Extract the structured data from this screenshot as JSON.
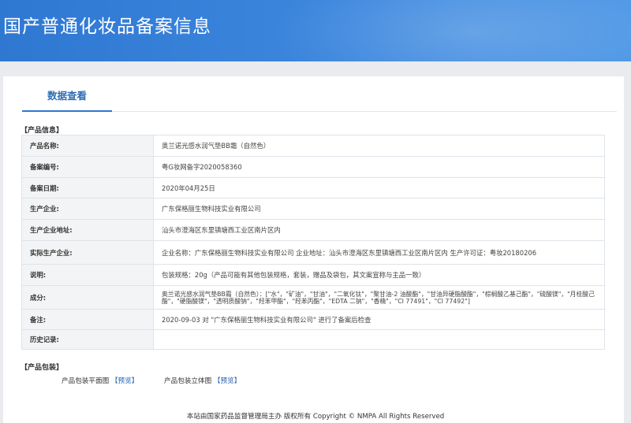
{
  "header": {
    "title": "国产普通化妆品备案信息"
  },
  "tab": {
    "label": "数据查看"
  },
  "product_info": {
    "section_title": "【产品信息】",
    "rows": [
      {
        "label": "产品名称:",
        "value": "奥兰诺光感水润气垫BB霜（自然色）"
      },
      {
        "label": "备案编号:",
        "value": "粤G妆网备字2020058360"
      },
      {
        "label": "备案日期:",
        "value": "2020年04月25日"
      },
      {
        "label": "生产企业:",
        "value": "广东保格丽生物科技实业有限公司"
      },
      {
        "label": "生产企业地址:",
        "value": "汕头市澄海区东里镇塘西工业区南片区内"
      },
      {
        "label": "实际生产企业:",
        "value": "企业名称：广东保格丽生物科技实业有限公司 企业地址：汕头市澄海区东里镇塘西工业区南片区内 生产许可证：粤妆20180206"
      },
      {
        "label": "说明:",
        "value": "包装规格：20g（产品可能有其他包装规格，套装，赠品及袋包，其文案宣称与主品一致）"
      },
      {
        "label": "成分:",
        "value": "奥兰诺光感水润气垫BB霜（自然色）：[\"水\"，\"矿油\"，\"甘油\"，\"二氧化钛\"，\"聚甘油-2 油酸酯\"，\"甘油异硬脂酸酯\"，\"棕榈酸乙基己酯\"，\"硫酸镁\"，\"月桂酸己酯\"，\"硬脂酸镁\"，\"透明质酸钠\"，\"羟苯甲酯\"，\"羟苯丙酯\"，\"EDTA 二钠\"，\"香精\"，\"CI 77491\"，\"CI 77492\"]"
      },
      {
        "label": "备注:",
        "value": "2020-09-03 对 \"广东保格丽生物科技实业有限公司\" 进行了备案后检查"
      },
      {
        "label": "历史记录:",
        "value": ""
      }
    ]
  },
  "packaging": {
    "section_title": "【产品包装】",
    "items": [
      {
        "label": "产品包装平面图",
        "link": "【预览】"
      },
      {
        "label": "产品包装立体图",
        "link": "【预览】"
      }
    ]
  },
  "footer": {
    "text": "本站由国家药品监督管理局主办 版权所有 Copyright © NMPA All Rights Reserved"
  }
}
